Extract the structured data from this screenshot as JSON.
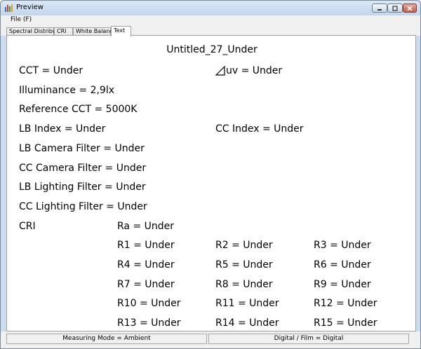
{
  "window": {
    "title": "Preview"
  },
  "menu": {
    "file": "File (F)"
  },
  "tabs": [
    {
      "label": "Spectral Distribution"
    },
    {
      "label": "CRI"
    },
    {
      "label": "White Balance"
    },
    {
      "label": "Text"
    }
  ],
  "content": {
    "heading": "Untitled_27_Under",
    "cct": "CCT = Under",
    "duv": "uv = Under",
    "illuminance": "Illuminance = 2,9lx",
    "reference_cct": "Reference CCT = 5000K",
    "lb_index": "LB Index = Under",
    "cc_index": "CC Index = Under",
    "lb_camera_filter": "LB Camera Filter = Under",
    "cc_camera_filter": "CC Camera Filter = Under",
    "lb_lighting_filter": "LB Lighting Filter = Under",
    "cc_lighting_filter": "CC Lighting Filter = Under",
    "cri_label": "CRI",
    "ra": "Ra = Under",
    "r_values": [
      "R1 = Under",
      "R2 = Under",
      "R3 = Under",
      "R4 = Under",
      "R5 = Under",
      "R6 = Under",
      "R7 = Under",
      "R8 = Under",
      "R9 = Under",
      "R10 = Under",
      "R11 = Under",
      "R12 = Under",
      "R13 = Under",
      "R14 = Under",
      "R15 = Under"
    ]
  },
  "status": {
    "measuring_mode": "Measuring Mode = Ambient",
    "digital_film": "Digital / Film = Digital"
  }
}
